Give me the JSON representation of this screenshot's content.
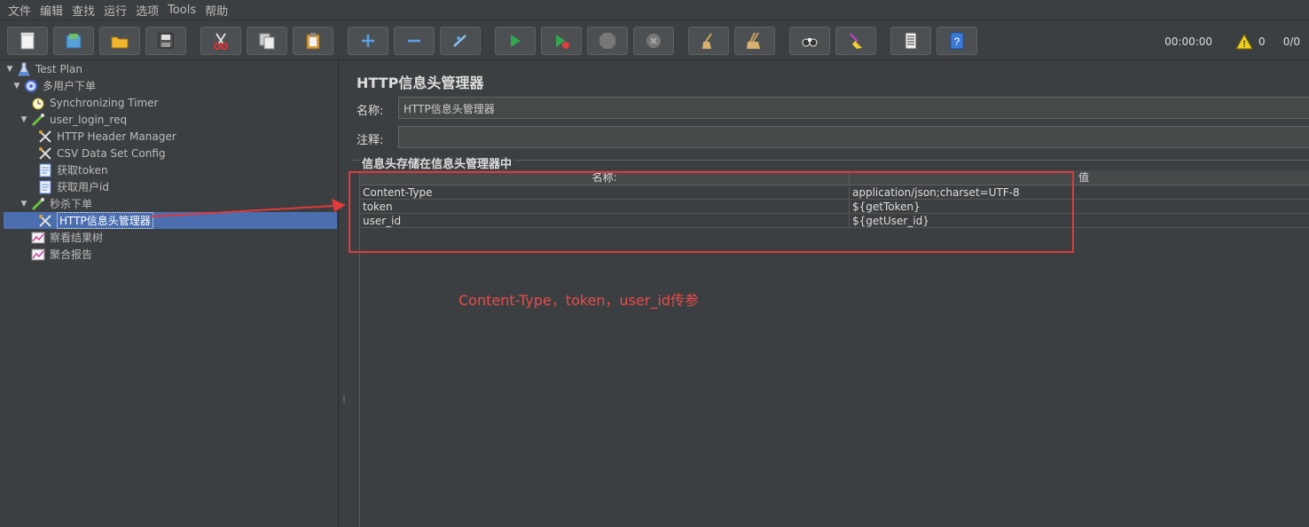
{
  "menu": [
    "文件",
    "编辑",
    "查找",
    "运行",
    "选项",
    "Tools",
    "帮助"
  ],
  "toolbar": {
    "buttons": [
      "new-icon",
      "templates-icon",
      "open-icon",
      "save-icon",
      "cut-icon",
      "copy-icon",
      "paste-icon",
      "expand-icon",
      "collapse-icon",
      "toggle-icon",
      "start-icon",
      "start-no-pause-icon",
      "stop-icon",
      "shutdown-icon",
      "clear-icon",
      "clear-all-icon",
      "search-icon",
      "reset-search-icon",
      "function-helper-icon",
      "help-icon"
    ],
    "elapsed": "00:00:00",
    "warnings": "0",
    "threads": "0/0"
  },
  "tree": [
    {
      "label": "Test Plan",
      "icon": "test-plan-icon",
      "level": 0,
      "expanded": true
    },
    {
      "label": "多用户下单",
      "icon": "thread-group-icon",
      "level": 1,
      "expanded": true
    },
    {
      "label": "Synchronizing Timer",
      "icon": "timer-icon",
      "level": 2
    },
    {
      "label": "user_login_req",
      "icon": "sampler-icon",
      "level": 2,
      "expanded": true
    },
    {
      "label": "HTTP Header Manager",
      "icon": "config-icon",
      "level": 3
    },
    {
      "label": "CSV Data Set Config",
      "icon": "config-icon",
      "level": 3
    },
    {
      "label": "获取token",
      "icon": "extractor-icon",
      "level": 3
    },
    {
      "label": "获取用户id",
      "icon": "extractor-icon",
      "level": 3
    },
    {
      "label": "秒杀下单",
      "icon": "sampler-icon",
      "level": 2,
      "expanded": true
    },
    {
      "label": "HTTP信息头管理器",
      "icon": "config-icon",
      "level": 3,
      "selected": true
    },
    {
      "label": "察看结果树",
      "icon": "listener-icon",
      "level": 2
    },
    {
      "label": "聚合报告",
      "icon": "listener-icon",
      "level": 2
    }
  ],
  "panel": {
    "title": "HTTP信息头管理器",
    "name_label": "名称:",
    "name_value": "HTTP信息头管理器",
    "comment_label": "注释:",
    "comment_value": "",
    "group_title": "信息头存储在信息头管理器中",
    "columns": [
      "名称:",
      "值"
    ],
    "rows": [
      [
        "Content-Type",
        "application/json;charset=UTF-8"
      ],
      [
        "token",
        "${getToken}"
      ],
      [
        "user_id",
        "${getUser_id}"
      ]
    ]
  },
  "annotation": "Content-Type，token，user_id传参",
  "colors": {
    "highlight": "#e03a3a",
    "selection": "#4b6eaf",
    "background": "#3c3f41"
  }
}
